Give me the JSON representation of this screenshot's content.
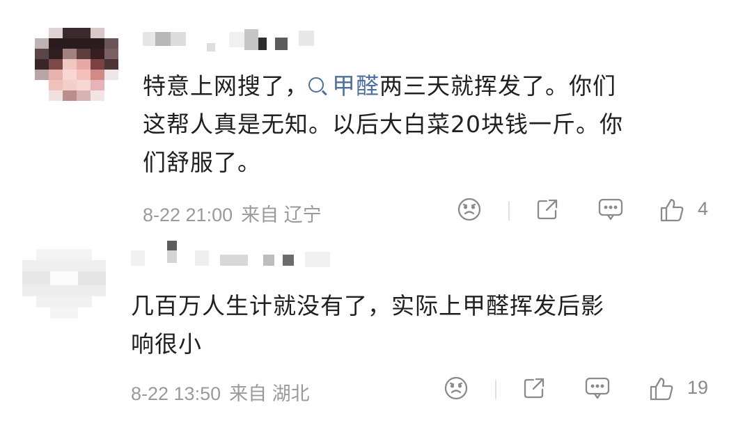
{
  "comments": [
    {
      "segments": [
        {
          "text": "特意上网搜了，",
          "kind": "plain"
        },
        {
          "text": "甲醛",
          "kind": "mention"
        },
        {
          "text": "两三天就挥发了。你们\n这帮人真是无知。以后大白菜20块钱一斤。你\n们舒服了。",
          "kind": "plain"
        }
      ],
      "time": "8-22 21:00",
      "location": "来自 辽宁",
      "likes": "4"
    },
    {
      "segments": [
        {
          "text": "几百万人生计就没有了，实际上甲醛挥发后影\n响很小",
          "kind": "plain"
        }
      ],
      "time": "8-22 13:50",
      "location": "来自 湖北",
      "likes": "19"
    }
  ],
  "icons": [
    "dislike-face-icon",
    "share-icon",
    "comment-icon",
    "thumbs-up-icon"
  ],
  "colors": {
    "text": "#202020",
    "meta": "#9a9a9a",
    "mention": "#4a6fa0",
    "icon": "#8a8a8a"
  }
}
